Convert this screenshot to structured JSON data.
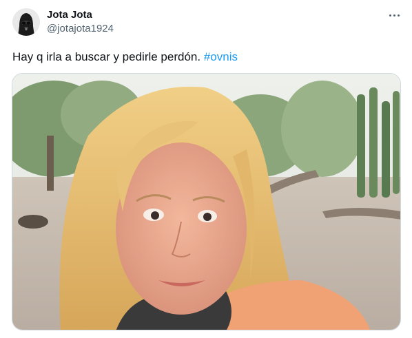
{
  "tweet": {
    "author": {
      "display_name": "Jota Jota",
      "handle": "@jotajota1924",
      "avatar_icon": "darth-vader-avatar"
    },
    "more_icon": "more-horizontal-icon",
    "text": "Hay q irla a buscar y pedirle perdón.",
    "hashtag": "#ovnis",
    "media": {
      "alt": ""
    }
  },
  "colors": {
    "hashtag": "#1d9bf0",
    "secondary_text": "#536471",
    "primary_text": "#0f1419",
    "border": "#cfd9de"
  }
}
